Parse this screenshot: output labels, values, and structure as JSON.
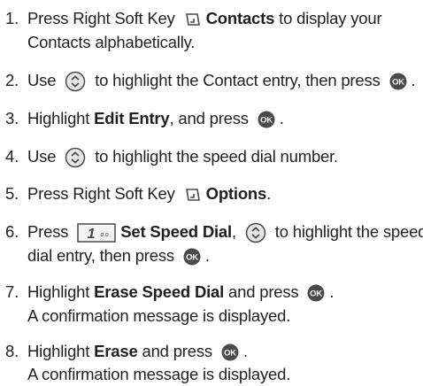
{
  "steps": [
    {
      "num": "1.",
      "t1": "Press Right Soft Key ",
      "b1": "Contacts",
      "t2": " to display your",
      "line2": "Contacts alphabetically."
    },
    {
      "num": "2.",
      "t1": "Use ",
      "t2": " to highlight the Contact entry, then press ",
      "t3": "."
    },
    {
      "num": "3.",
      "t1": "Highlight ",
      "b1": "Edit Entry",
      "t2": ", and press ",
      "t3": "."
    },
    {
      "num": "4.",
      "t1": "Use ",
      "t2": " to highlight the speed dial number."
    },
    {
      "num": "5.",
      "t1": "Press Right Soft Key ",
      "b1": "Options",
      "t2": "."
    },
    {
      "num": "6.",
      "t1": "Press ",
      "key_label": "1",
      "key_sub": "o.o",
      "b1": "Set Speed Dial",
      "t2": ", ",
      "t3": " to highlight the speed",
      "line2a": "dial entry, then press ",
      "line2b": "."
    },
    {
      "num": "7.",
      "t1": "Highlight ",
      "b1": "Erase Speed Dial",
      "t2": " and press ",
      "t3": ".",
      "line2": "A confirmation message is displayed."
    },
    {
      "num": "8.",
      "t1": "Highlight ",
      "b1": "Erase",
      "t2": " and press ",
      "t3": ".",
      "line2": "A confirmation message is displayed."
    }
  ],
  "icons": {
    "ok_label": "OK",
    "ok_color": "#4a4a4a",
    "nav_color": "#4a4a4a",
    "nav_fill": "#e6e6e6"
  }
}
